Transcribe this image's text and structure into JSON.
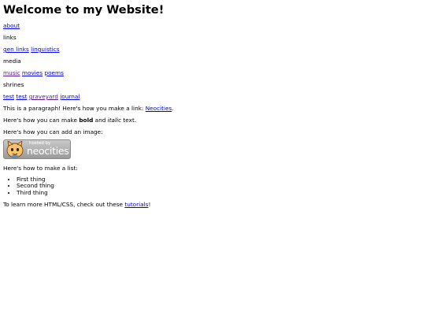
{
  "page": {
    "title": "Welcome to my Website!"
  },
  "nav": {
    "about": "about",
    "links_heading": "links",
    "gen_links": "gen links",
    "linguistics": "linguistics",
    "media_heading": "media",
    "music": "music",
    "movies": "movies",
    "poems": "poems",
    "shrines_heading": "shrines",
    "test1": "test",
    "test2": "test",
    "graveyard": "graveyard",
    "journal": "journal"
  },
  "content": {
    "para1_text": "This is a paragraph! Here's how you make a link: ",
    "para1_link": "Neocities",
    "para1_end": ".",
    "para2_start": "Here's how you can make ",
    "para2_bold": "bold",
    "para2_mid": " and ",
    "para2_italic": "italic",
    "para2_end": " text.",
    "para3": "Here's how you can add an image:",
    "badge_hosted": "hosted by",
    "badge_brand": "neocities",
    "list_intro": "Here's how to make a list:",
    "list_items": [
      "First thing",
      "Second thing",
      "Third thing"
    ],
    "footer_text": "To learn more HTML/CSS, check out these ",
    "footer_link": "tutorials",
    "footer_end": "!"
  },
  "colors": {
    "link": "#0000ee",
    "visited_link": "#551a8b",
    "badge_bg": "#a8a8a8"
  }
}
